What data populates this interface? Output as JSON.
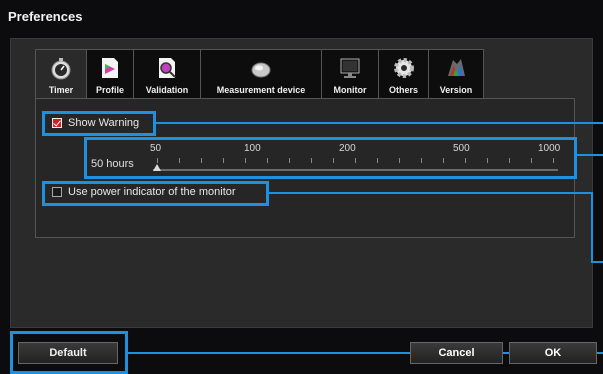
{
  "window": {
    "title": "Preferences"
  },
  "tabs": [
    {
      "label": "Timer",
      "icon": "stopwatch-icon"
    },
    {
      "label": "Profile",
      "icon": "profile-icon"
    },
    {
      "label": "Validation",
      "icon": "validation-icon"
    },
    {
      "label": "Measurement device",
      "icon": "sensor-icon"
    },
    {
      "label": "Monitor",
      "icon": "monitor-icon"
    },
    {
      "label": "Others",
      "icon": "gear-icon"
    },
    {
      "label": "Version",
      "icon": "version-icon"
    }
  ],
  "timer": {
    "show_warning": {
      "label": "Show Warning",
      "checked": true
    },
    "slider": {
      "value_label": "50 hours",
      "ticks": [
        "50",
        "100",
        "200",
        "500",
        "1000"
      ],
      "value": 50
    },
    "power_indicator": {
      "label": "Use power indicator of the monitor",
      "checked": false
    }
  },
  "footer": {
    "default_label": "Default",
    "cancel_label": "Cancel",
    "ok_label": "OK"
  },
  "colors": {
    "highlight": "#1e90e0",
    "checkbox_checked": "#d52020"
  }
}
